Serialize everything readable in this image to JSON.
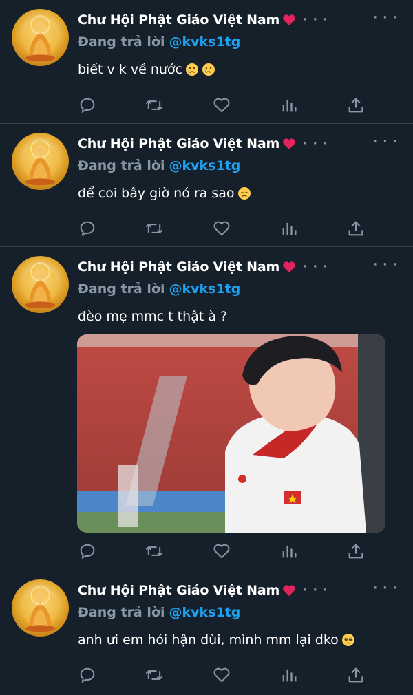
{
  "tweets": [
    {
      "author": "Chư Hội Phật Giáo Việt Nam",
      "reply_prefix": "Đang trả lời",
      "reply_handle": "@kvks1tg",
      "text": "biết v k về nước",
      "emojis": [
        "crying-face",
        "crying-face"
      ]
    },
    {
      "author": "Chư Hội Phật Giáo Việt Nam",
      "reply_prefix": "Đang trả lời",
      "reply_handle": "@kvks1tg",
      "text": "để coi bây giờ nó ra sao",
      "emojis": [
        "disappointed-face"
      ]
    },
    {
      "author": "Chư Hội Phật Giáo Việt Nam",
      "reply_prefix": "Đang trả lời",
      "reply_handle": "@kvks1tg",
      "text": "đèo mẹ mmc t thật à ?",
      "emojis": [],
      "has_media": true
    },
    {
      "author": "Chư Hội Phật Giáo Việt Nam",
      "reply_prefix": "Đang trả lời",
      "reply_handle": "@kvks1tg",
      "text": "anh ưi em hói hận dùi, mình mm lại dko",
      "emojis": [
        "pleading-face"
      ]
    }
  ],
  "icons": {
    "name_badge": "red-heart-icon",
    "more": "more-dots-icon",
    "actions": [
      "reply-icon",
      "retweet-icon",
      "like-icon",
      "analytics-icon",
      "share-icon"
    ]
  },
  "colors": {
    "background": "#15202b",
    "divider": "#38444d",
    "secondary_text": "#8899a6",
    "link": "#1da1f2",
    "heart": "#e0245e"
  }
}
